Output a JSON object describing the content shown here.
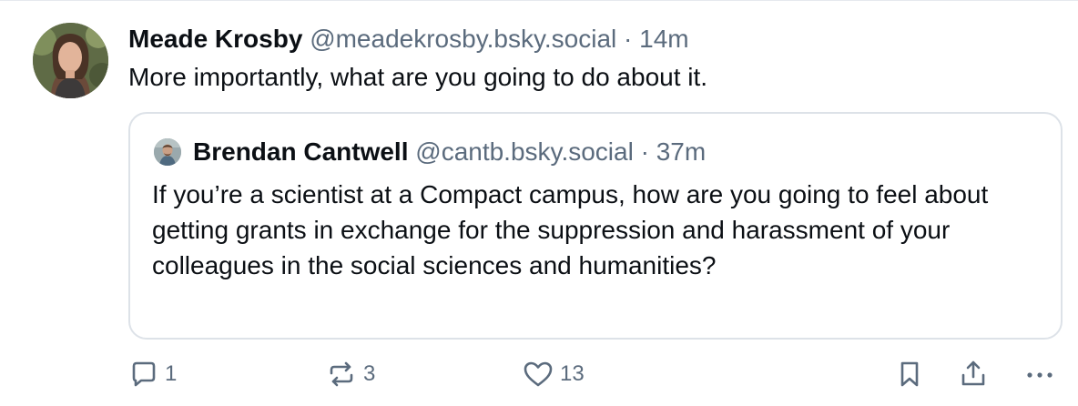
{
  "post": {
    "author": {
      "display_name": "Meade Krosby",
      "handle": "@meadekrosby.bsky.social",
      "separator": "·",
      "time": "14m"
    },
    "text": "More importantly, what are you going to do about it.",
    "quote": {
      "author": {
        "display_name": "Brendan Cantwell",
        "handle": "@cantb.bsky.social",
        "separator": "·",
        "time": "37m"
      },
      "text": "If you’re a scientist at a Compact campus, how are you going to feel about getting grants in exchange for the suppression and harassment of your colleagues in the social sciences and humanities?"
    },
    "actions": {
      "reply_count": "1",
      "repost_count": "3",
      "like_count": "13"
    }
  },
  "icons": {
    "reply": "reply-icon",
    "repost": "repost-icon",
    "like": "heart-icon",
    "bookmark": "bookmark-icon",
    "share": "share-icon",
    "more": "more-options-icon"
  },
  "colors": {
    "text_primary": "#0b0f14",
    "text_secondary": "#5b6b7d",
    "border": "#dde2e8"
  }
}
